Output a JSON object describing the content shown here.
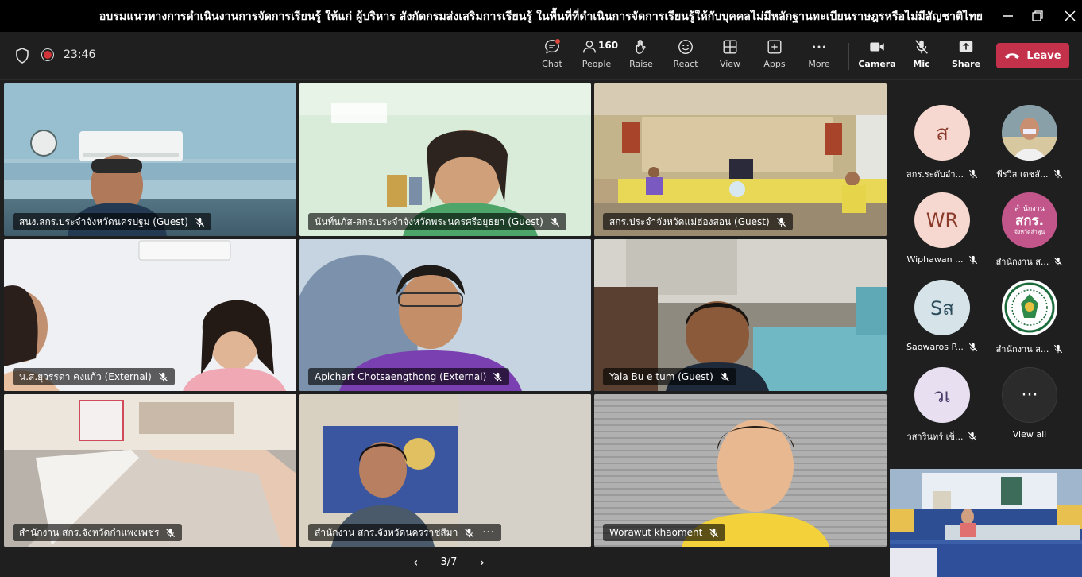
{
  "window": {
    "title": "อบรมแนวทางการดำเนินงานการจัดการเรียนรู้ ให้แก่ ผู้บริหาร สังกัดกรมส่งเสริมการเรียนรู้ ในพื้นที่ที่ดำเนินการจัดการเรียนรู้ให้กับบุคคลไม่มีหลักฐานทะเบียนราษฎรหรือไม่มีสัญชาติไทย"
  },
  "toolbar": {
    "timer": "23:46",
    "chat_label": "Chat",
    "people_label": "People",
    "people_count": "160",
    "raise_label": "Raise",
    "react_label": "React",
    "view_label": "View",
    "apps_label": "Apps",
    "more_label": "More",
    "camera_label": "Camera",
    "mic_label": "Mic",
    "share_label": "Share",
    "leave_label": "Leave"
  },
  "tiles": [
    {
      "name": "สนง.สกร.ประจำจังหวัดนครปฐม (Guest)"
    },
    {
      "name": "นันท์นภัส-สกร.ประจำจังหวัดพระนครศรีอยุธยา (Guest)"
    },
    {
      "name": "สกร.ประจำจังหวัดแม่ฮ่องสอน (Guest)"
    },
    {
      "name": "น.ส.ยุวรรดา คงแก้ว (External)"
    },
    {
      "name": "Apichart Chotsaengthong (External)"
    },
    {
      "name": "Yala Bu e tum (Guest)"
    },
    {
      "name": "สำนักงาน สกร.จังหวัดกำแพงเพชร"
    },
    {
      "name": "สำนักงาน สกร.จังหวัดนครราชสีมา"
    },
    {
      "name": "Worawut khaoment"
    }
  ],
  "roster": [
    {
      "initials": "ส",
      "name": "สกร.ระดับอำ...",
      "bg": "#f6d8d0",
      "fg": "#8a3a2a"
    },
    {
      "initials": "",
      "name": "พีรวิส เดชสั...",
      "bg": "#4a6b7a",
      "fg": "#fff"
    },
    {
      "initials": "WR",
      "name": "Wiphawan ...",
      "bg": "#f6d8d0",
      "fg": "#8a3a2a"
    },
    {
      "initials": "สกร.",
      "name": "สำนักงาน ส...",
      "bg": "#c2568b",
      "fg": "#fff",
      "logo_text": "สำนักงาน",
      "logo_sub": "จังหวัดลำพูน"
    },
    {
      "initials": "Sส",
      "name": "Saowaros P...",
      "bg": "#d6e4ea",
      "fg": "#2d4d5c"
    },
    {
      "initials": "",
      "name": "สำนักงาน ส...",
      "bg": "#ffffff",
      "fg": "#1b6b3a"
    },
    {
      "initials": "วเ",
      "name": "วสารินทร์ เข็...",
      "bg": "#e8e0f0",
      "fg": "#4a3a6a"
    },
    {
      "initials": "···",
      "name": "View all",
      "bg": "#2b2b2b",
      "fg": "#fff"
    }
  ],
  "pager": {
    "text": "3/7"
  },
  "colors": {
    "leave": "#c4314b",
    "toolbar": "#1f1f1f",
    "titlebar": "#000000"
  }
}
